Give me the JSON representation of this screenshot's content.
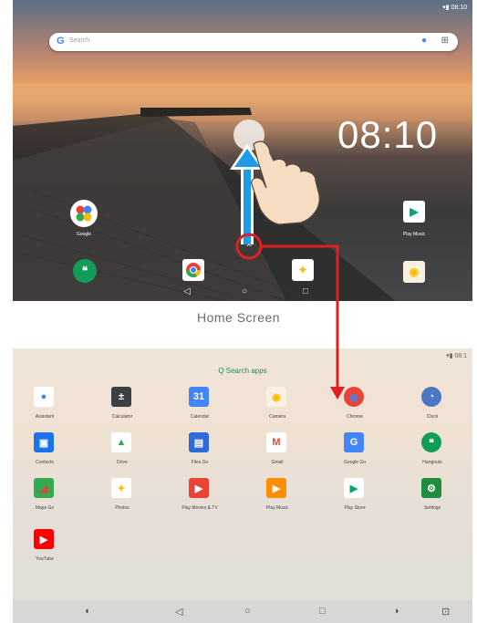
{
  "home": {
    "search_placeholder": "Search",
    "google_g": "G",
    "clock": "08:10",
    "date": "",
    "folder_label": "Google",
    "playstore_label": "Play Music"
  },
  "caption": "Home Screen",
  "drawer": {
    "search": "Q  Search apps",
    "apps": [
      {
        "label": "Assistant",
        "glyph": "●",
        "bg": "#ffffff",
        "fg": "#4285f4"
      },
      {
        "label": "Calculator",
        "glyph": "±",
        "bg": "#3c4043",
        "fg": "#ffffff"
      },
      {
        "label": "Calendar",
        "glyph": "31",
        "bg": "#4285f4",
        "fg": "#ffffff"
      },
      {
        "label": "Camera",
        "glyph": "◉",
        "bg": "#f8f1e0",
        "fg": "#fbbc04"
      },
      {
        "label": "Chrome",
        "glyph": "◍",
        "bg": "#ea4335",
        "fg": "#4285f4"
      },
      {
        "label": "Clock",
        "glyph": "◔",
        "bg": "#4a76c4",
        "fg": "#ffffff"
      },
      {
        "label": "Contacts",
        "glyph": "▣",
        "bg": "#1a73e8",
        "fg": "#ffffff"
      },
      {
        "label": "Drive",
        "glyph": "▲",
        "bg": "#ffffff",
        "fg": "#34a853"
      },
      {
        "label": "Files Go",
        "glyph": "▤",
        "bg": "#2f6bd8",
        "fg": "#ffffff"
      },
      {
        "label": "Gmail",
        "glyph": "M",
        "bg": "#ffffff",
        "fg": "#ea4335"
      },
      {
        "label": "Google Go",
        "glyph": "G",
        "bg": "#4285f4",
        "fg": "#ffffff"
      },
      {
        "label": "Hangouts",
        "glyph": "❝",
        "bg": "#0f9d58",
        "fg": "#ffffff"
      },
      {
        "label": "Maps Go",
        "glyph": "◢",
        "bg": "#34a853",
        "fg": "#ea4335"
      },
      {
        "label": "Photos",
        "glyph": "✦",
        "bg": "#ffffff",
        "fg": "#fbbc04"
      },
      {
        "label": "Play Movies & TV",
        "glyph": "▶",
        "bg": "#ea4335",
        "fg": "#ffffff"
      },
      {
        "label": "Play Music",
        "glyph": "▶",
        "bg": "#ff8f00",
        "fg": "#ffffff"
      },
      {
        "label": "Play Store",
        "glyph": "▶",
        "bg": "#ffffff",
        "fg": "#00a173"
      },
      {
        "label": "Settings",
        "glyph": "⚙",
        "bg": "#1e8e3e",
        "fg": "#ffffff"
      },
      {
        "label": "YouTube",
        "glyph": "▶",
        "bg": "#ff0000",
        "fg": "#ffffff"
      }
    ]
  },
  "colors": {
    "swipe_arrow": "#1e9be8",
    "callout": "#e02020"
  }
}
